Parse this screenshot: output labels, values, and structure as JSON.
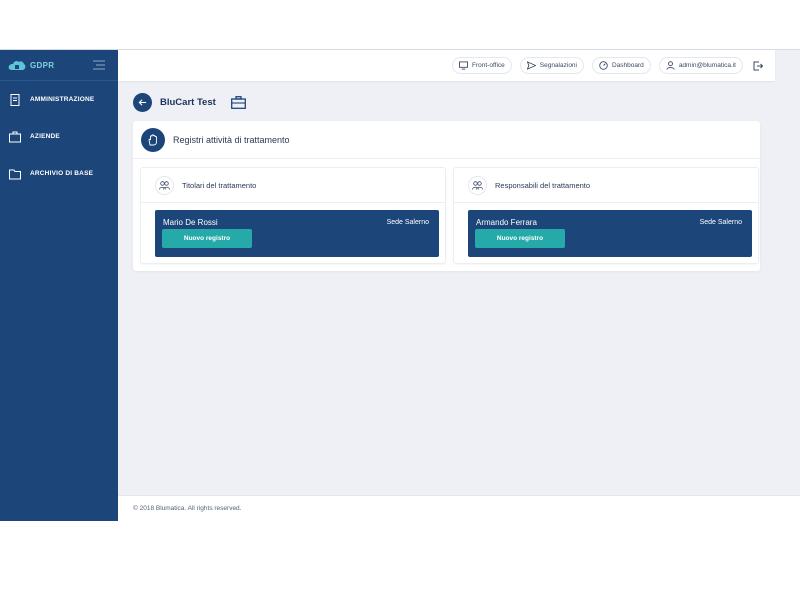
{
  "sidebar": {
    "logo_text": "GDPR",
    "items": [
      {
        "label": "AMMINISTRAZIONE",
        "icon": "document-icon"
      },
      {
        "label": "AZIENDE",
        "icon": "briefcase-icon"
      },
      {
        "label": "ARCHIVIO DI BASE",
        "icon": "folder-icon"
      }
    ]
  },
  "topbar": {
    "front_office": "Front-office",
    "segnalazioni": "Segnalazioni",
    "dashboard": "Dashboard",
    "user": "admin@blumatica.it"
  },
  "page": {
    "company": "BluCart Test"
  },
  "main": {
    "title": "Registri attività di trattamento",
    "titolari": {
      "title": "Titolari del trattamento",
      "name": "Mario De Rossi",
      "site": "Sede Salerno",
      "button": "Nuovo registro"
    },
    "responsabili": {
      "title": "Responsabili del trattamento",
      "name": "Armando Ferrara",
      "site": "Sede Salerno",
      "button": "Nuovo registro"
    }
  },
  "footer": {
    "text": "© 2018 Blumatica. All rights reserved."
  },
  "colors": {
    "primary": "#1c4679",
    "accent": "#25aaa9",
    "background": "#eef0f5"
  }
}
